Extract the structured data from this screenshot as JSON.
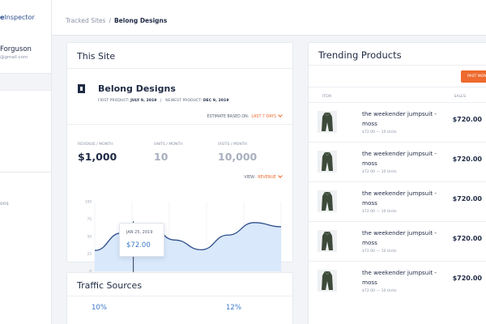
{
  "sidebar": {
    "brand_prefix": "e",
    "brand_suffix": "Inspector",
    "user_name": "Forguson",
    "user_email": "@gmail.com",
    "fragment": "ons"
  },
  "topbar": {
    "breadcrumb_root": "Tracked Sites",
    "breadcrumb_separator": "/",
    "breadcrumb_current": "Belong Designs"
  },
  "this_site": {
    "title": "This Site",
    "site_name": "Belong Designs",
    "first_product_label": "FIRST PRODUCT:",
    "first_product_date": "JULY 9, 2019",
    "date_separator": "|",
    "newest_product_label": "NEWEST PRODUCT:",
    "newest_product_date": "DEC 9, 2019",
    "estimate_label": "ESTIMATE BASED ON:",
    "estimate_value": "LAST 7 DAYS",
    "metrics": [
      {
        "label": "REVENUE / MONTH",
        "value": "$1,000"
      },
      {
        "label": "UNITS / MONTH",
        "value": "10"
      },
      {
        "label": "VISITS / MONTH",
        "value": "10,000"
      }
    ],
    "view_label": "VIEW:",
    "view_value": "REVENUE",
    "tooltip_date": "JAN 25, 2019",
    "tooltip_value": "$72.00"
  },
  "chart_data": {
    "type": "area",
    "x": [
      "",
      "",
      "",
      "",
      "",
      ""
    ],
    "y_ticks": [
      "100",
      "75",
      "50",
      "25",
      "0"
    ],
    "ylim": [
      0,
      100
    ],
    "values": [
      30,
      55,
      68,
      45,
      31,
      52,
      70,
      64
    ],
    "highlight_value": 72.0,
    "colors": {
      "line": "#2e4f8c",
      "fill": "#d9e8fb",
      "tooltip_value": "#3c78c8"
    }
  },
  "traffic": {
    "title": "Traffic Sources",
    "values": [
      "10%",
      "12%"
    ]
  },
  "trending": {
    "title": "Trending Products",
    "time_button": "PAST MONTH",
    "col_item": "ITEM",
    "col_sales": "SALES",
    "products": [
      {
        "name": "the weekender jumpsuit - moss",
        "meta": "$72.00 — 10 Units",
        "price": "$720.00"
      },
      {
        "name": "the weekender jumpsuit - moss",
        "meta": "$72.00 — 10 Units",
        "price": "$720.00"
      },
      {
        "name": "the weekender jumpsuit - moss",
        "meta": "$72.00 — 10 Units",
        "price": "$720.00"
      },
      {
        "name": "the weekender jumpsuit - moss",
        "meta": "$72.00 — 10 Units",
        "price": "$720.00"
      },
      {
        "name": "the weekender jumpsuit - moss",
        "meta": "$72.00 — 10 Units",
        "price": "$720.00"
      }
    ]
  },
  "colors": {
    "accent": "#ee6a2e",
    "brand": "#2e4f8c",
    "link_blue": "#3c78c8"
  }
}
